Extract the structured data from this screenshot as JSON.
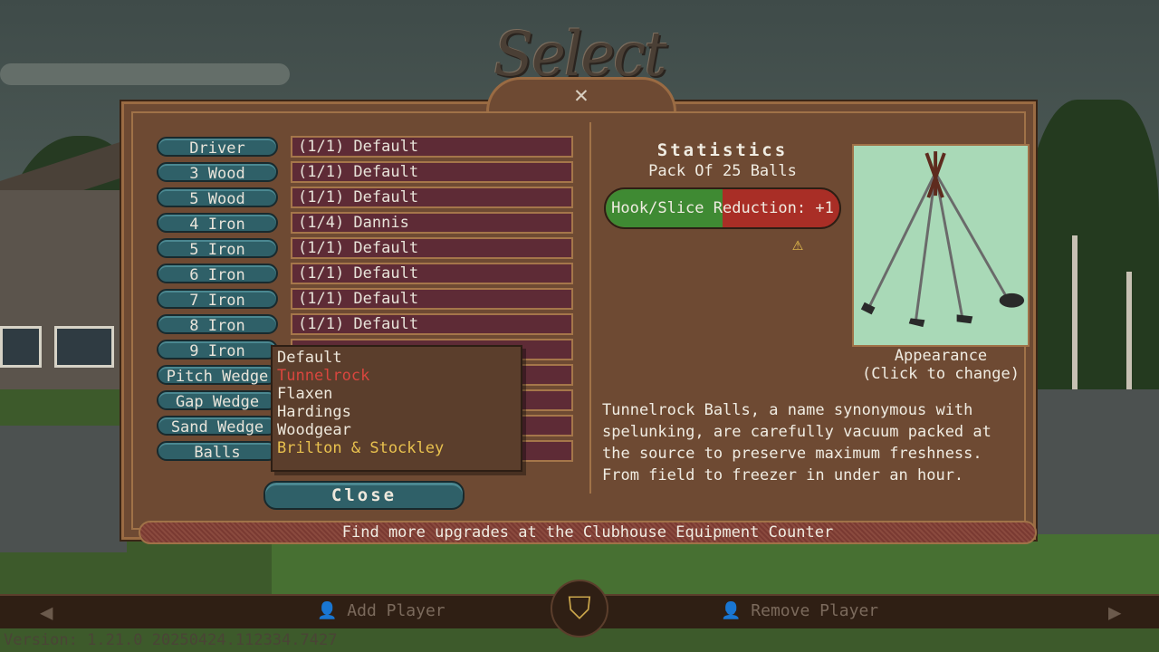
{
  "title": "Select Players",
  "clubs": [
    {
      "label": "Driver",
      "value": "(1/1) Default"
    },
    {
      "label": "3 Wood",
      "value": "(1/1) Default"
    },
    {
      "label": "5 Wood",
      "value": "(1/1) Default"
    },
    {
      "label": "4 Iron",
      "value": "(1/4) Dannis"
    },
    {
      "label": "5 Iron",
      "value": "(1/1) Default"
    },
    {
      "label": "6 Iron",
      "value": "(1/1) Default"
    },
    {
      "label": "7 Iron",
      "value": "(1/1) Default"
    },
    {
      "label": "8 Iron",
      "value": "(1/1) Default"
    },
    {
      "label": "9 Iron",
      "value": ""
    },
    {
      "label": "Pitch Wedge",
      "value": ""
    },
    {
      "label": "Gap Wedge",
      "value": ""
    },
    {
      "label": "Sand Wedge",
      "value": ""
    },
    {
      "label": "Balls",
      "value": ""
    }
  ],
  "dropdown": {
    "options": [
      "Default",
      "Tunnelrock",
      "Flaxen",
      "Hardings",
      "Woodgear",
      "Brilton & Stockley"
    ]
  },
  "close_label": "Close",
  "stats": {
    "title": "Statistics",
    "subtitle": "Pack Of 25 Balls",
    "bar_label": "Hook/Slice Reduction: +1",
    "bar_fraction": 0.5
  },
  "appearance": {
    "line1": "Appearance",
    "line2": "(Click to change)"
  },
  "description": "Tunnelrock Balls, a name synonymous with spelunking, are carefully vacuum packed at the source to preserve maximum freshness. From field to freezer in under an hour.",
  "footer": "Find more upgrades at the Clubhouse Equipment Counter",
  "bottom": {
    "add_player": "Add Player",
    "remove_player": "Remove Player"
  },
  "version": "Version: 1.21.0 20250424.112334.7427",
  "colors": {
    "bar_green": "#3f8a33",
    "bar_red": "#a92e26",
    "highlight_red": "#d8463e",
    "gold": "#e8c14e"
  },
  "icons": [
    "crossed-clubs-icon",
    "warning-icon",
    "left-arrow-icon",
    "right-arrow-icon",
    "person-icon",
    "shield-emblem-icon"
  ]
}
